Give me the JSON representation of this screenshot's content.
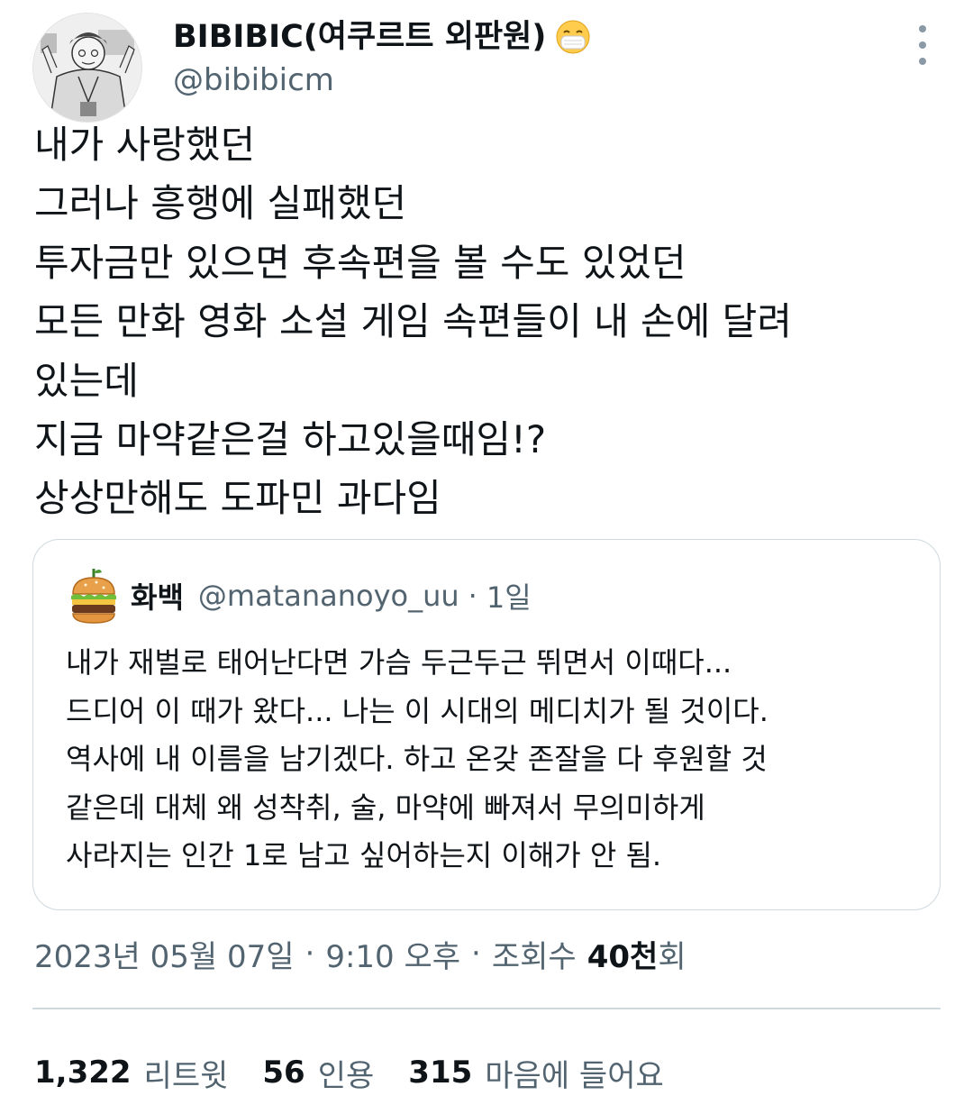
{
  "author": {
    "display_name": "BIBIBIC(여쿠르트 외판원)",
    "emoji": "mask-face-emoji",
    "handle": "@bibibicm",
    "avatar_icon": "sketch-portrait-avatar"
  },
  "more_icon": "more-vertical-icon",
  "tweet_lines": [
    "내가 사랑했던",
    "그러나 흥행에 실패했던",
    "투자금만 있으면 후속편을 볼 수도 있었던",
    "모든 만화 영화 소설 게임 속편들이 내 손에 달려",
    "있는데",
    "지금 마약같은걸 하고있을때임!?",
    "상상만해도 도파민 과다임"
  ],
  "quote": {
    "avatar_icon": "hamburger-avatar",
    "name": "화백",
    "handle": "@matananoyo_uu",
    "separator": "·",
    "time": "1일",
    "lines": [
      "내가 재벌로 태어난다면 가슴 두근두근 뛰면서 이때다...",
      "드디어 이 때가 왔다... 나는 이 시대의 메디치가 될 것이다.",
      "역사에 내 이름을 남기겠다. 하고 온갖 존잘을 다 후원할 것",
      "같은데 대체 왜 성착취, 술, 마약에 빠져서 무의미하게",
      "사라지는 인간 1로 남고 싶어하는지 이해가 안 됨."
    ]
  },
  "meta": {
    "date": "2023년 05월 07일",
    "separator": "·",
    "time": "9:10 오후",
    "views_label": "조회수",
    "views_count": "40천",
    "views_suffix": "회"
  },
  "stats": [
    {
      "count": "1,322",
      "label": "리트윗"
    },
    {
      "count": "56",
      "label": "인용"
    },
    {
      "count": "315",
      "label": "마음에 들어요"
    }
  ],
  "colors": {
    "text": "#0f1419",
    "secondary": "#536471",
    "border": "#cfd9de"
  }
}
